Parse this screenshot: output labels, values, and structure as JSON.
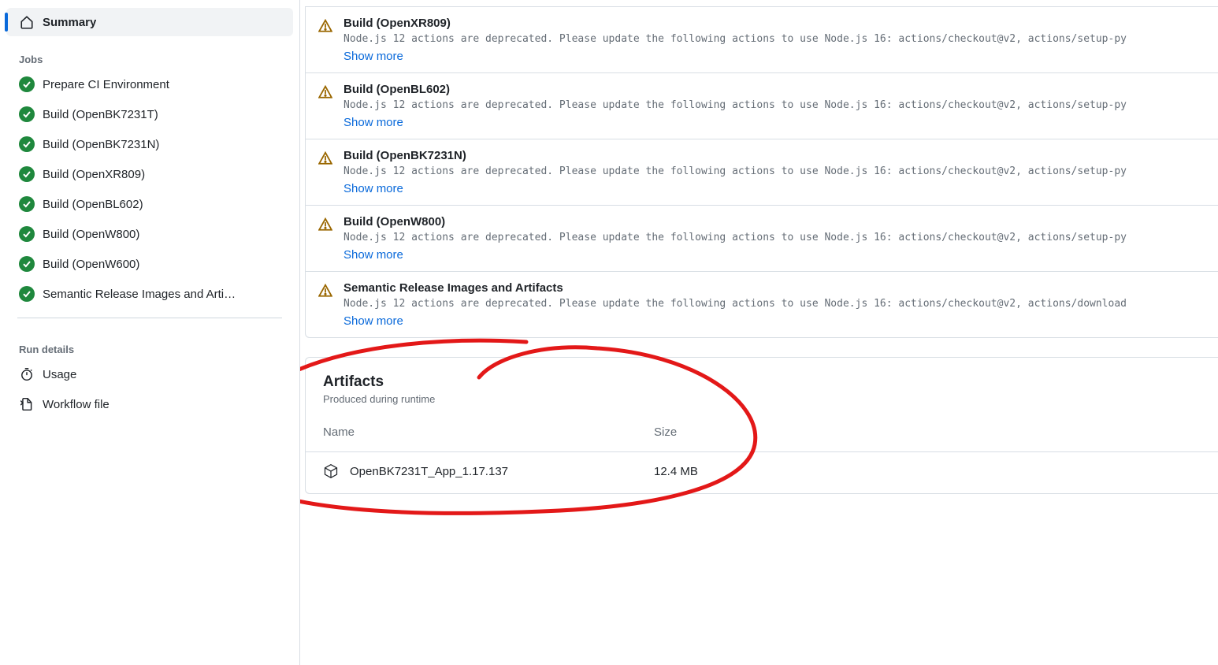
{
  "sidebar": {
    "summary_label": "Summary",
    "jobs_header": "Jobs",
    "jobs": [
      {
        "label": "Prepare CI Environment"
      },
      {
        "label": "Build (OpenBK7231T)"
      },
      {
        "label": "Build (OpenBK7231N)"
      },
      {
        "label": "Build (OpenXR809)"
      },
      {
        "label": "Build (OpenBL602)"
      },
      {
        "label": "Build (OpenW800)"
      },
      {
        "label": "Build (OpenW600)"
      },
      {
        "label": "Semantic Release Images and Arti…"
      }
    ],
    "run_details_header": "Run details",
    "usage_label": "Usage",
    "workflow_file_label": "Workflow file"
  },
  "annotations": [
    {
      "title": "Build (OpenXR809)",
      "message": "Node.js 12 actions are deprecated. Please update the following actions to use Node.js 16: actions/checkout@v2, actions/setup-py",
      "show_more": "Show more"
    },
    {
      "title": "Build (OpenBL602)",
      "message": "Node.js 12 actions are deprecated. Please update the following actions to use Node.js 16: actions/checkout@v2, actions/setup-py",
      "show_more": "Show more"
    },
    {
      "title": "Build (OpenBK7231N)",
      "message": "Node.js 12 actions are deprecated. Please update the following actions to use Node.js 16: actions/checkout@v2, actions/setup-py",
      "show_more": "Show more"
    },
    {
      "title": "Build (OpenW800)",
      "message": "Node.js 12 actions are deprecated. Please update the following actions to use Node.js 16: actions/checkout@v2, actions/setup-py",
      "show_more": "Show more"
    },
    {
      "title": "Semantic Release Images and Artifacts",
      "message": "Node.js 12 actions are deprecated. Please update the following actions to use Node.js 16: actions/checkout@v2, actions/download",
      "show_more": "Show more"
    }
  ],
  "artifacts": {
    "heading": "Artifacts",
    "subheading": "Produced during runtime",
    "col_name": "Name",
    "col_size": "Size",
    "items": [
      {
        "name": "OpenBK7231T_App_1.17.137",
        "size": "12.4 MB"
      }
    ]
  }
}
